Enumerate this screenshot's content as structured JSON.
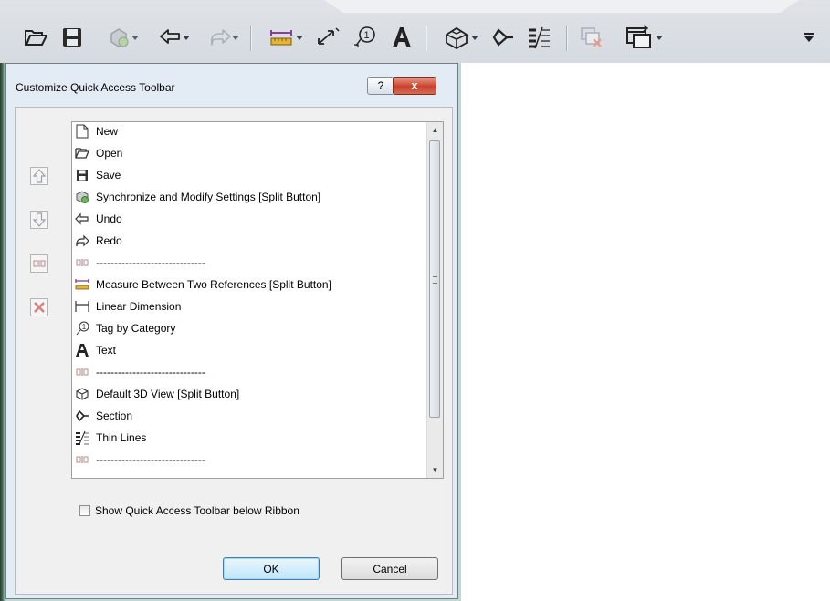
{
  "toolbar": {
    "items": [
      {
        "id": "open",
        "icon": "folder-open-icon"
      },
      {
        "id": "save",
        "icon": "floppy-disk-icon"
      },
      {
        "id": "sync",
        "icon": "sync-settings-icon",
        "split": true,
        "disabled": true
      },
      {
        "id": "undo",
        "icon": "undo-icon",
        "split": true
      },
      {
        "id": "redo",
        "icon": "redo-icon",
        "split": true,
        "disabled": true
      },
      {
        "id": "measure",
        "icon": "measure-icon",
        "split": true
      },
      {
        "id": "aligned-dim",
        "icon": "aligned-dimension-icon",
        "split": true
      },
      {
        "id": "tag",
        "icon": "tag-icon"
      },
      {
        "id": "text",
        "icon": "text-icon"
      },
      {
        "id": "3dview",
        "icon": "3d-view-icon",
        "split": true
      },
      {
        "id": "section",
        "icon": "section-icon"
      },
      {
        "id": "thin-lines",
        "icon": "thin-lines-icon"
      },
      {
        "id": "close-windows",
        "icon": "close-windows-icon",
        "disabled": true
      },
      {
        "id": "switch-windows",
        "icon": "switch-windows-icon",
        "split": true
      },
      {
        "id": "customize",
        "icon": "customize-dropdown-icon"
      }
    ]
  },
  "dialog": {
    "title": "Customize Quick Access Toolbar",
    "help_label": "?",
    "close_label": "x",
    "side_buttons": [
      {
        "name": "move-up-button",
        "icon": "arrow-up-icon"
      },
      {
        "name": "move-down-button",
        "icon": "arrow-down-icon"
      },
      {
        "name": "add-separator-button",
        "icon": "separator-icon"
      },
      {
        "name": "delete-button",
        "icon": "delete-x-icon"
      }
    ],
    "list_items": [
      {
        "label": "New",
        "icon": "new-document-icon"
      },
      {
        "label": "Open",
        "icon": "folder-open-icon"
      },
      {
        "label": "Save",
        "icon": "floppy-disk-icon"
      },
      {
        "label": "Synchronize and Modify Settings [Split Button]",
        "icon": "sync-settings-icon"
      },
      {
        "label": "Undo",
        "icon": "undo-icon"
      },
      {
        "label": "Redo",
        "icon": "redo-icon"
      },
      {
        "label": "------------------------------",
        "icon": "separator-icon"
      },
      {
        "label": "Measure Between Two References [Split Button]",
        "icon": "measure-icon"
      },
      {
        "label": "Linear Dimension",
        "icon": "linear-dimension-icon"
      },
      {
        "label": "Tag by Category",
        "icon": "tag-icon"
      },
      {
        "label": "Text",
        "icon": "text-icon"
      },
      {
        "label": "------------------------------",
        "icon": "separator-icon"
      },
      {
        "label": "Default 3D View [Split Button]",
        "icon": "3d-view-icon"
      },
      {
        "label": "Section",
        "icon": "section-icon"
      },
      {
        "label": "Thin Lines",
        "icon": "thin-lines-icon"
      },
      {
        "label": "------------------------------",
        "icon": "separator-icon"
      }
    ],
    "checkbox_label": "Show Quick Access Toolbar below Ribbon",
    "checkbox_checked": false,
    "ok_label": "OK",
    "cancel_label": "Cancel"
  }
}
